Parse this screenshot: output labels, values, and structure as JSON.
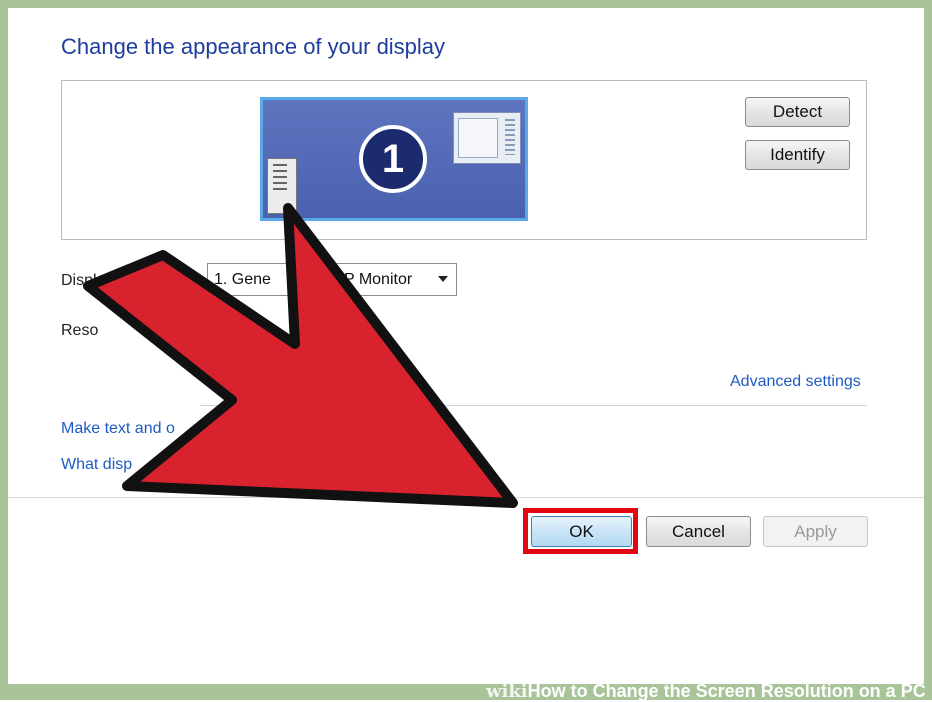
{
  "heading": "Change the appearance of your display",
  "monitor_panel": {
    "screen_number": "1",
    "detect_label": "Detect",
    "identify_label": "Identify"
  },
  "form": {
    "display_label_visible": "Displ",
    "display_value_left": "1. Gene",
    "display_value_right": "P Monitor",
    "resolution_label_visible": "Reso"
  },
  "links": {
    "advanced_settings": "Advanced settings",
    "make_text_visible": "Make text and o",
    "what_display_visible": "What disp"
  },
  "buttons": {
    "ok": "OK",
    "cancel": "Cancel",
    "apply": "Apply"
  },
  "watermark": {
    "brand": "wiki",
    "title": "How to Change the Screen Resolution on a PC"
  },
  "colors": {
    "heading_blue": "#1e3d9c",
    "link_blue": "#1e5bc2",
    "highlight_red": "#e30613",
    "arrow_red": "#d8232f",
    "frame_green": "#a9c499"
  }
}
